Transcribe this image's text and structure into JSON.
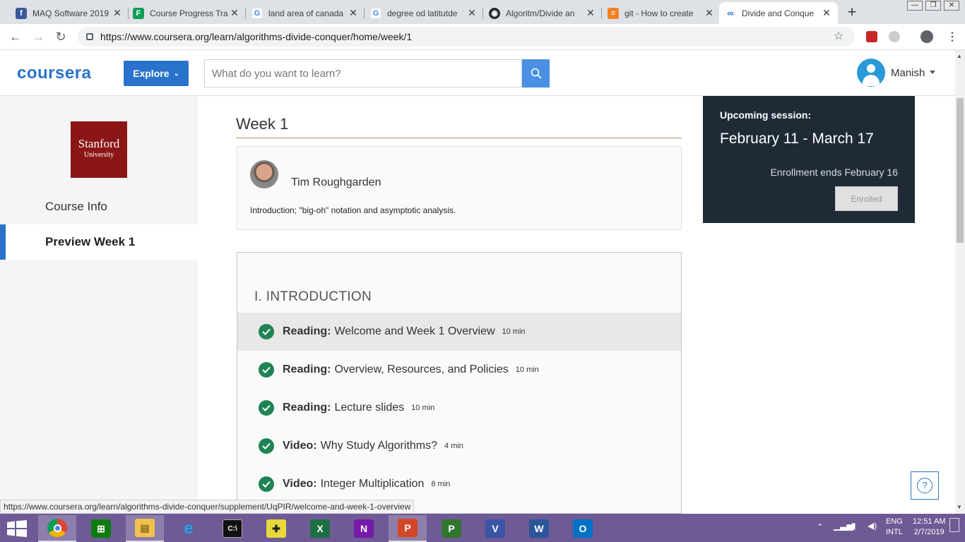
{
  "browser": {
    "tabs": [
      {
        "title": "MAQ Software 2019",
        "favicon": "facebook-icon",
        "color": "#3b5998"
      },
      {
        "title": "Course Progress Tra",
        "favicon": "sheets-icon",
        "color": "#0f9d58"
      },
      {
        "title": "land area of canada",
        "favicon": "google-icon",
        "color": "#4285f4"
      },
      {
        "title": "degree od latitutde",
        "favicon": "google-icon",
        "color": "#4285f4"
      },
      {
        "title": "Algoritm/Divide an",
        "favicon": "github-icon",
        "color": "#24292e"
      },
      {
        "title": "git - How to create",
        "favicon": "stackoverflow-icon",
        "color": "#f48024"
      },
      {
        "title": "Divide and Conque",
        "favicon": "coursera-icon",
        "color": "#2a73cc"
      }
    ],
    "url": "https://www.coursera.org/learn/algorithms-divide-conquer/home/week/1"
  },
  "header": {
    "logo": "coursera",
    "explore_label": "Explore",
    "search_placeholder": "What do you want to learn?",
    "user_name": "Manish"
  },
  "sidebar": {
    "logo_line1": "Stanford",
    "logo_line2": "University",
    "items": [
      {
        "label": "Course Info"
      },
      {
        "label": "Preview Week 1"
      }
    ]
  },
  "main": {
    "week_title": "Week 1",
    "instructor": {
      "name": "Tim Roughgarden",
      "description": "Introduction; \"big-oh\" notation and asymptotic analysis."
    },
    "module": {
      "title": "I. INTRODUCTION",
      "items": [
        {
          "type": "Reading:",
          "name": "Welcome and Week 1 Overview",
          "duration": "10 min"
        },
        {
          "type": "Reading:",
          "name": "Overview, Resources, and Policies",
          "duration": "10 min"
        },
        {
          "type": "Reading:",
          "name": "Lecture slides",
          "duration": "10 min"
        },
        {
          "type": "Video:",
          "name": "Why Study Algorithms?",
          "duration": "4 min"
        },
        {
          "type": "Video:",
          "name": "Integer Multiplication",
          "duration": "8 min"
        }
      ]
    }
  },
  "session": {
    "label": "Upcoming session:",
    "dates": "February 11 - March 17",
    "enrollment": "Enrollment ends February 16",
    "button": "Enrolled"
  },
  "help_label": "?",
  "status_link": "https://www.coursera.org/learn/algorithms-divide-conquer/supplement/UqPIR/welcome-and-week-1-overview",
  "taskbar": {
    "lang1": "ENG",
    "lang2": "INTL",
    "time": "12:51 AM",
    "date": "2/7/2019"
  },
  "colors": {
    "brand": "#2a73cc",
    "check": "#1f8354",
    "session_bg": "#1f2a37",
    "stanford": "#8c1515"
  }
}
